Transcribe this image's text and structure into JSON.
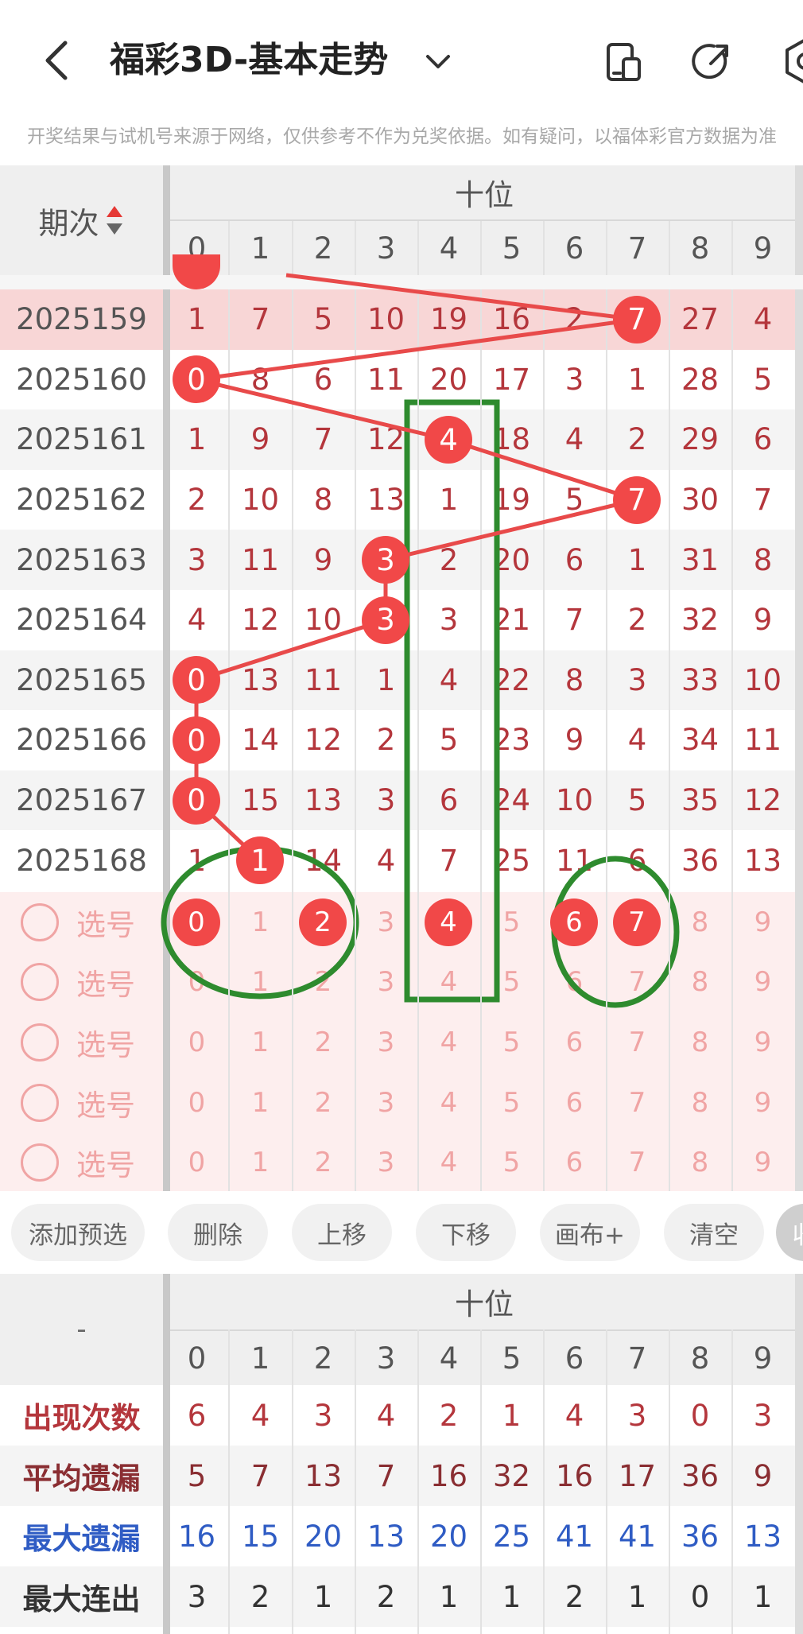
{
  "header": {
    "title": "福彩3D-基本走势",
    "back_icon": "chevron-left-icon",
    "dropdown_icon": "chevron-down-icon",
    "device_icon": "device-icon",
    "share_icon": "share-icon",
    "settings_icon": "gear-icon"
  },
  "notice": "开奖结果与试机号来源于网络，仅供参考不作为兑奖依据。如有疑问，以福体彩官方数据为准",
  "table": {
    "period_header": "期次",
    "section_header": "十位",
    "digits": [
      "0",
      "1",
      "2",
      "3",
      "4",
      "5",
      "6",
      "7",
      "8",
      "9"
    ],
    "rows": [
      {
        "period": "2025159",
        "values": [
          "1",
          "7",
          "5",
          "10",
          "19",
          "16",
          "2",
          "7",
          "27",
          "4"
        ],
        "hit": 7
      },
      {
        "period": "2025160",
        "values": [
          "0",
          "8",
          "6",
          "11",
          "20",
          "17",
          "3",
          "1",
          "28",
          "5"
        ],
        "hit": 0
      },
      {
        "period": "2025161",
        "values": [
          "1",
          "9",
          "7",
          "12",
          "4",
          "18",
          "4",
          "2",
          "29",
          "6"
        ],
        "hit": 4
      },
      {
        "period": "2025162",
        "values": [
          "2",
          "10",
          "8",
          "13",
          "1",
          "19",
          "5",
          "7",
          "30",
          "7"
        ],
        "hit": 7
      },
      {
        "period": "2025163",
        "values": [
          "3",
          "11",
          "9",
          "3",
          "2",
          "20",
          "6",
          "1",
          "31",
          "8"
        ],
        "hit": 3
      },
      {
        "period": "2025164",
        "values": [
          "4",
          "12",
          "10",
          "3",
          "3",
          "21",
          "7",
          "2",
          "32",
          "9"
        ],
        "hit": 3
      },
      {
        "period": "2025165",
        "values": [
          "0",
          "13",
          "11",
          "1",
          "4",
          "22",
          "8",
          "3",
          "33",
          "10"
        ],
        "hit": 0
      },
      {
        "period": "2025166",
        "values": [
          "0",
          "14",
          "12",
          "2",
          "5",
          "23",
          "9",
          "4",
          "34",
          "11"
        ],
        "hit": 0
      },
      {
        "period": "2025167",
        "values": [
          "0",
          "15",
          "13",
          "3",
          "6",
          "24",
          "10",
          "5",
          "35",
          "12"
        ],
        "hit": 0
      },
      {
        "period": "2025168",
        "values": [
          "1",
          "1",
          "14",
          "4",
          "7",
          "25",
          "11",
          "6",
          "36",
          "13"
        ],
        "hit": 1
      }
    ],
    "select_rows": [
      {
        "label": "选号",
        "digits": [
          "0",
          "1",
          "2",
          "3",
          "4",
          "5",
          "6",
          "7",
          "8",
          "9"
        ],
        "selected": [
          0,
          2,
          4,
          6,
          7
        ]
      },
      {
        "label": "选号",
        "digits": [
          "0",
          "1",
          "2",
          "3",
          "4",
          "5",
          "6",
          "7",
          "8",
          "9"
        ],
        "selected": []
      },
      {
        "label": "选号",
        "digits": [
          "0",
          "1",
          "2",
          "3",
          "4",
          "5",
          "6",
          "7",
          "8",
          "9"
        ],
        "selected": []
      },
      {
        "label": "选号",
        "digits": [
          "0",
          "1",
          "2",
          "3",
          "4",
          "5",
          "6",
          "7",
          "8",
          "9"
        ],
        "selected": []
      },
      {
        "label": "选号",
        "digits": [
          "0",
          "1",
          "2",
          "3",
          "4",
          "5",
          "6",
          "7",
          "8",
          "9"
        ],
        "selected": []
      }
    ]
  },
  "toolbar": {
    "add_preselect": "添加预选",
    "delete": "删除",
    "move_up": "上移",
    "move_down": "下移",
    "canvas": "画布+",
    "clear": "清空",
    "collapse": "收"
  },
  "stats": {
    "corner": "-",
    "section_header": "十位",
    "digits": [
      "0",
      "1",
      "2",
      "3",
      "4",
      "5",
      "6",
      "7",
      "8",
      "9"
    ],
    "rows": [
      {
        "label": "出现次数",
        "values": [
          "6",
          "4",
          "3",
          "4",
          "2",
          "1",
          "4",
          "3",
          "0",
          "3"
        ],
        "label_color": "#b4363c",
        "value_color": "#b4363c"
      },
      {
        "label": "平均遗漏",
        "values": [
          "5",
          "7",
          "13",
          "7",
          "16",
          "32",
          "16",
          "17",
          "36",
          "9"
        ],
        "label_color": "#8a2e32",
        "value_color": "#8a2e32"
      },
      {
        "label": "最大遗漏",
        "values": [
          "16",
          "15",
          "20",
          "13",
          "20",
          "25",
          "41",
          "41",
          "36",
          "13"
        ],
        "label_color": "#2f5cc4",
        "value_color": "#2f5cc4"
      },
      {
        "label": "最大连出",
        "values": [
          "3",
          "2",
          "1",
          "2",
          "1",
          "1",
          "2",
          "1",
          "0",
          "1"
        ],
        "label_color": "#333333",
        "value_color": "#333333"
      }
    ]
  },
  "colors": {
    "ball": "#f14848",
    "annotation": "#2e8b2e",
    "line": "#e84a4a"
  }
}
